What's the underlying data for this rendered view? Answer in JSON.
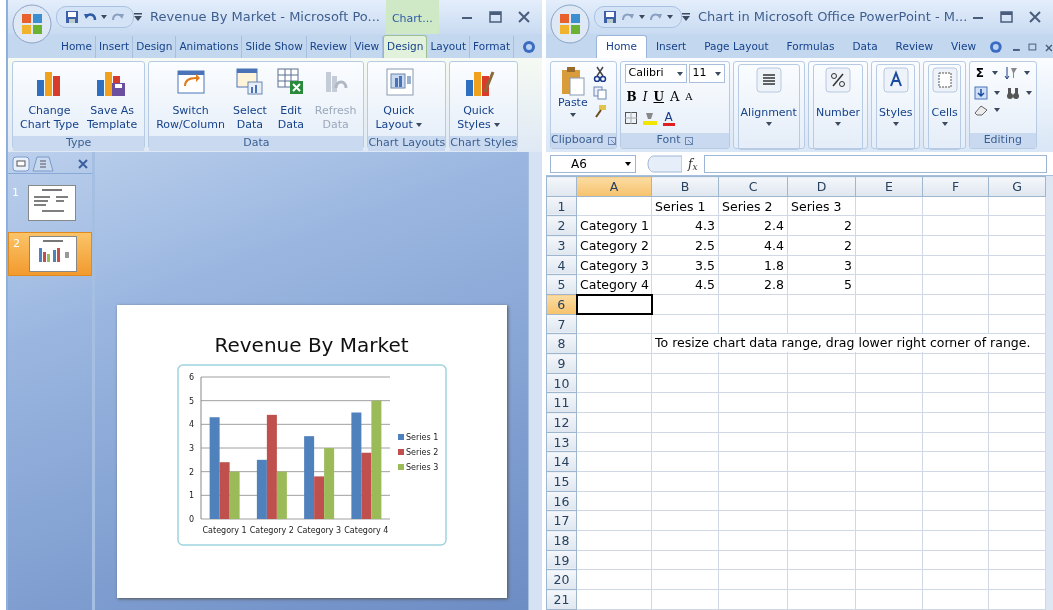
{
  "left_window": {
    "title": "Revenue By Market - Microsoft Po...",
    "context_tab": "Chart...",
    "tabs": [
      {
        "label": "Home",
        "selected": false
      },
      {
        "label": "Insert",
        "selected": false
      },
      {
        "label": "Design",
        "selected": false
      },
      {
        "label": "Animations",
        "selected": false
      },
      {
        "label": "Slide Show",
        "selected": false
      },
      {
        "label": "Review",
        "selected": false
      },
      {
        "label": "View",
        "selected": false
      },
      {
        "label": "Design",
        "selected": true
      },
      {
        "label": "Layout",
        "selected": false
      },
      {
        "label": "Format",
        "selected": false
      }
    ],
    "ribbon_groups": [
      {
        "label": "Type",
        "buttons": [
          {
            "lines": [
              "Change",
              "Chart Type"
            ],
            "disabled": false,
            "dropdown": false
          },
          {
            "lines": [
              "Save As",
              "Template"
            ],
            "disabled": false,
            "dropdown": false
          }
        ]
      },
      {
        "label": "Data",
        "buttons": [
          {
            "lines": [
              "Switch",
              "Row/Column"
            ],
            "disabled": false,
            "dropdown": false
          },
          {
            "lines": [
              "Select",
              "Data"
            ],
            "disabled": false,
            "dropdown": false
          },
          {
            "lines": [
              "Edit",
              "Data"
            ],
            "disabled": false,
            "dropdown": false
          },
          {
            "lines": [
              "Refresh",
              "Data"
            ],
            "disabled": true,
            "dropdown": false
          }
        ]
      },
      {
        "label": "Chart Layouts",
        "buttons": [
          {
            "lines": [
              "Quick",
              "Layout"
            ],
            "disabled": false,
            "dropdown": true
          }
        ]
      },
      {
        "label": "Chart Styles",
        "buttons": [
          {
            "lines": [
              "Quick",
              "Styles"
            ],
            "disabled": false,
            "dropdown": true
          }
        ]
      }
    ],
    "slides": [
      {
        "number": "1",
        "selected": false
      },
      {
        "number": "2",
        "selected": true
      }
    ],
    "slide": {
      "title": "Revenue By Market",
      "chart_data": {
        "type": "bar",
        "categories": [
          "Category 1",
          "Category 2",
          "Category 3",
          "Category 4"
        ],
        "series": [
          {
            "name": "Series 1",
            "color": "#4f81bd",
            "values": [
              4.3,
              2.5,
              3.5,
              4.5
            ]
          },
          {
            "name": "Series 2",
            "color": "#c0504d",
            "values": [
              2.4,
              4.4,
              1.8,
              2.8
            ]
          },
          {
            "name": "Series 3",
            "color": "#9bbb59",
            "values": [
              2,
              2,
              3,
              5
            ]
          }
        ],
        "ylim": [
          0,
          6
        ],
        "yticks": [
          0,
          1,
          2,
          3,
          4,
          5,
          6
        ],
        "grid": true,
        "legend": "right"
      }
    }
  },
  "right_window": {
    "title": "Chart in Microsoft Office PowerPoint - M...",
    "tabs": [
      {
        "label": "Home",
        "selected": true
      },
      {
        "label": "Insert",
        "selected": false
      },
      {
        "label": "Page Layout",
        "selected": false
      },
      {
        "label": "Formulas",
        "selected": false
      },
      {
        "label": "Data",
        "selected": false
      },
      {
        "label": "Review",
        "selected": false
      },
      {
        "label": "View",
        "selected": false
      }
    ],
    "clipboard": {
      "paste": "Paste",
      "label": "Clipboard"
    },
    "font": {
      "name": "Calibri",
      "size": "11",
      "buttons": [
        {
          "text": "B",
          "kind": "bold"
        },
        {
          "text": "I",
          "kind": "italic"
        },
        {
          "text": "U",
          "kind": "underline"
        },
        {
          "text": "A",
          "kind": "grow"
        },
        {
          "text": "A",
          "kind": "shrink"
        }
      ],
      "color_letter": "A",
      "label": "Font"
    },
    "format_buttons": [
      {
        "label": "Alignment"
      },
      {
        "label": "Number"
      },
      {
        "label": "Styles"
      },
      {
        "label": "Cells"
      }
    ],
    "editing": {
      "sum": "Σ",
      "label": "Editing"
    },
    "formula_bar": {
      "name_box": "A6",
      "function_label": "f$_{x}$"
    },
    "sheet": {
      "columns": [
        {
          "label": "A",
          "selected": true
        },
        {
          "label": "B",
          "selected": false
        },
        {
          "label": "C",
          "selected": false
        },
        {
          "label": "D",
          "selected": false
        },
        {
          "label": "E",
          "selected": false
        },
        {
          "label": "F",
          "selected": false
        },
        {
          "label": "G",
          "selected": false
        }
      ],
      "rows": [
        {
          "number": "1",
          "selected": false,
          "cells": [
            null,
            {
              "text": "Series 1",
              "kind": "text"
            },
            {
              "text": "Series 2",
              "kind": "text"
            },
            {
              "text": "Series 3",
              "kind": "text"
            }
          ]
        },
        {
          "number": "2",
          "selected": false,
          "cells": [
            {
              "text": "Category 1",
              "kind": "text"
            },
            {
              "text": "4.3",
              "kind": "number"
            },
            {
              "text": "2.4",
              "kind": "number"
            },
            {
              "text": "2",
              "kind": "number"
            }
          ]
        },
        {
          "number": "3",
          "selected": false,
          "cells": [
            {
              "text": "Category 2",
              "kind": "text"
            },
            {
              "text": "2.5",
              "kind": "number"
            },
            {
              "text": "4.4",
              "kind": "number"
            },
            {
              "text": "2",
              "kind": "number"
            }
          ]
        },
        {
          "number": "4",
          "selected": false,
          "cells": [
            {
              "text": "Category 3",
              "kind": "text"
            },
            {
              "text": "3.5",
              "kind": "number"
            },
            {
              "text": "1.8",
              "kind": "number"
            },
            {
              "text": "3",
              "kind": "number"
            }
          ]
        },
        {
          "number": "5",
          "selected": false,
          "cells": [
            {
              "text": "Category 4",
              "kind": "text"
            },
            {
              "text": "4.5",
              "kind": "number"
            },
            {
              "text": "2.8",
              "kind": "number"
            },
            {
              "text": "5",
              "kind": "number"
            }
          ]
        },
        {
          "number": "6",
          "selected": true,
          "cells": []
        },
        {
          "number": "7",
          "selected": false,
          "cells": []
        },
        {
          "number": "8",
          "selected": false,
          "cells": [
            null,
            {
              "text": "To resize chart data range, drag lower right corner of range.",
              "kind": "note"
            }
          ]
        },
        {
          "number": "9",
          "selected": false,
          "cells": []
        },
        {
          "number": "10",
          "selected": false,
          "cells": []
        },
        {
          "number": "11",
          "selected": false,
          "cells": []
        },
        {
          "number": "12",
          "selected": false,
          "cells": []
        },
        {
          "number": "13",
          "selected": false,
          "cells": []
        },
        {
          "number": "14",
          "selected": false,
          "cells": []
        },
        {
          "number": "15",
          "selected": false,
          "cells": []
        },
        {
          "number": "16",
          "selected": false,
          "cells": []
        },
        {
          "number": "17",
          "selected": false,
          "cells": []
        },
        {
          "number": "18",
          "selected": false,
          "cells": []
        },
        {
          "number": "19",
          "selected": false,
          "cells": []
        },
        {
          "number": "20",
          "selected": false,
          "cells": []
        },
        {
          "number": "21",
          "selected": false,
          "cells": []
        }
      ]
    }
  }
}
